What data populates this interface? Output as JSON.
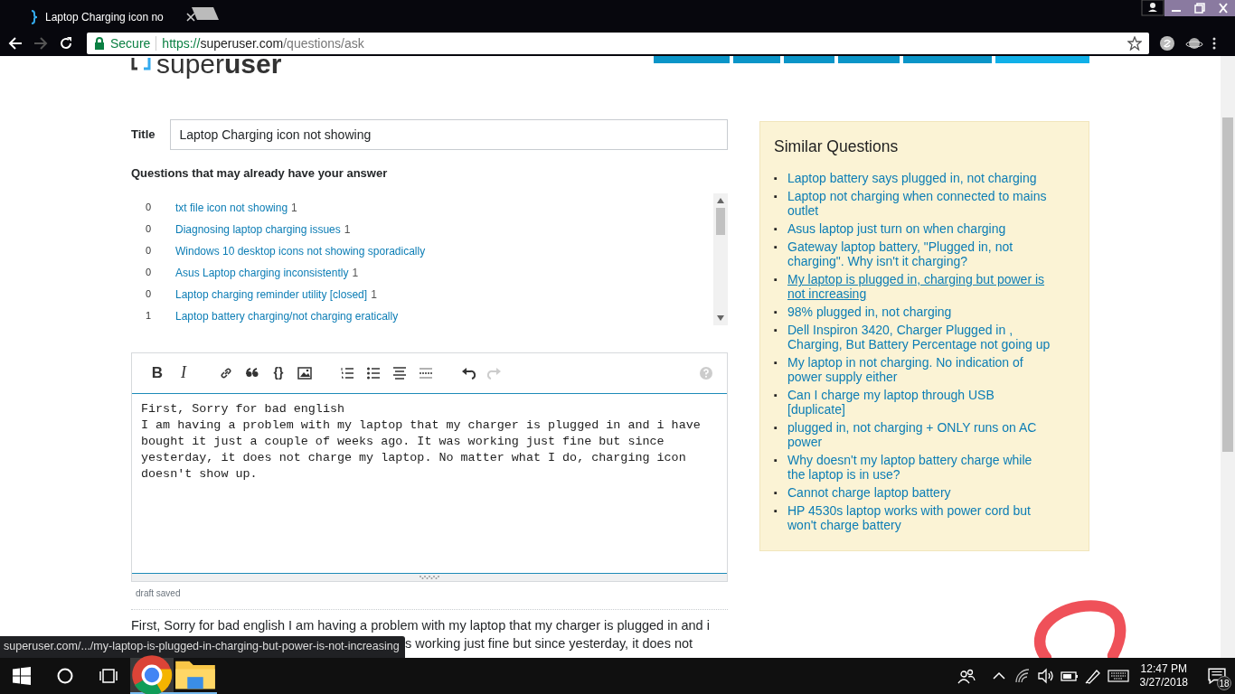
{
  "browser": {
    "tab": {
      "title": "Laptop Charging icon no"
    },
    "address": {
      "secure_label": "Secure",
      "scheme": "https://",
      "host": "superuser.com",
      "path": "/questions/ask"
    }
  },
  "site": {
    "logo_light": "super",
    "logo_bold": "user",
    "nav_tabs": [
      {
        "selected": false
      },
      {
        "selected": false
      },
      {
        "selected": false
      },
      {
        "selected": false
      },
      {
        "selected": false
      },
      {
        "selected": true
      }
    ]
  },
  "form": {
    "title_label": "Title",
    "title_value": "Laptop Charging icon not showing",
    "suggest_heading": "Questions that may already have your answer",
    "suggestions": [
      {
        "votes": "0",
        "title": "txt file icon not showing",
        "answers": "1"
      },
      {
        "votes": "0",
        "title": "Diagnosing laptop charging issues",
        "answers": "1"
      },
      {
        "votes": "0",
        "title": "Windows 10 desktop icons not showing sporadically"
      },
      {
        "votes": "0",
        "title": "Asus Laptop charging inconsistently",
        "answers": "1"
      },
      {
        "votes": "0",
        "title": "Laptop charging reminder utility [closed]",
        "answers": "1"
      },
      {
        "votes": "1",
        "title": "Laptop battery charging/not charging eratically"
      }
    ]
  },
  "editor": {
    "toolbar": [
      {
        "kind": "bold",
        "label": "B",
        "disabled": false
      },
      {
        "kind": "italic",
        "label": "I",
        "disabled": false
      },
      {
        "kind": "link",
        "disabled": false
      },
      {
        "kind": "quote",
        "disabled": false
      },
      {
        "kind": "code",
        "label": "{}",
        "disabled": false
      },
      {
        "kind": "image",
        "disabled": false
      },
      {
        "kind": "olist",
        "disabled": false
      },
      {
        "kind": "ulist",
        "disabled": false
      },
      {
        "kind": "heading",
        "disabled": false
      },
      {
        "kind": "rule",
        "disabled": false
      },
      {
        "kind": "undo",
        "disabled": false
      },
      {
        "kind": "redo",
        "disabled": true
      }
    ],
    "body": "First, Sorry for bad english\nI am having a problem with my laptop that my charger is plugged in and i have bought it just a couple of weeks ago. It was working just fine but since yesterday, it does not charge my laptop. No matter what I do, charging icon doesn't show up.",
    "status": "draft saved",
    "preview_lines": [
      "First, Sorry for bad english I am having a problem with my laptop that my charger is plugged in and i",
      "s working just fine but since yesterday, it does not"
    ]
  },
  "sidebar": {
    "title": "Similar Questions",
    "bullet": "▪",
    "items": [
      {
        "title": "Laptop battery says plugged in, not charging",
        "hovered": false
      },
      {
        "title": "Laptop not charging when connected to mains outlet",
        "hovered": false
      },
      {
        "title": "Asus laptop just turn on when charging",
        "hovered": false
      },
      {
        "title": "Gateway laptop battery, \"Plugged in, not charging\". Why isn't it charging?",
        "hovered": false
      },
      {
        "title": "My laptop is plugged in, charging but power is not increasing",
        "hovered": true
      },
      {
        "title": "98% plugged in, not charging",
        "hovered": false
      },
      {
        "title": "Dell Inspiron 3420, Charger Plugged in , Charging, But Battery Percentage not going up",
        "hovered": false
      },
      {
        "title": "My laptop in not charging. No indication of power supply either",
        "hovered": false
      },
      {
        "title": "Can I charge my laptop through USB [duplicate]",
        "hovered": false
      },
      {
        "title": "plugged in, not charging + ONLY runs on AC power",
        "hovered": false
      },
      {
        "title": "Why doesn't my laptop battery charge while the laptop is in use?",
        "hovered": false
      },
      {
        "title": "Cannot charge laptop battery",
        "hovered": false
      },
      {
        "title": "HP 4530s laptop works with power cord but won't charge battery",
        "hovered": false
      }
    ]
  },
  "status_url": "superuser.com/.../my-laptop-is-plugged-in-charging-but-power-is-not-increasing",
  "taskbar": {
    "apps": [
      {
        "kind": "chrome",
        "selected": true
      },
      {
        "kind": "explorer",
        "selected": false
      }
    ],
    "time": "12:47 PM",
    "date": "3/27/2018",
    "notifications": "18"
  }
}
